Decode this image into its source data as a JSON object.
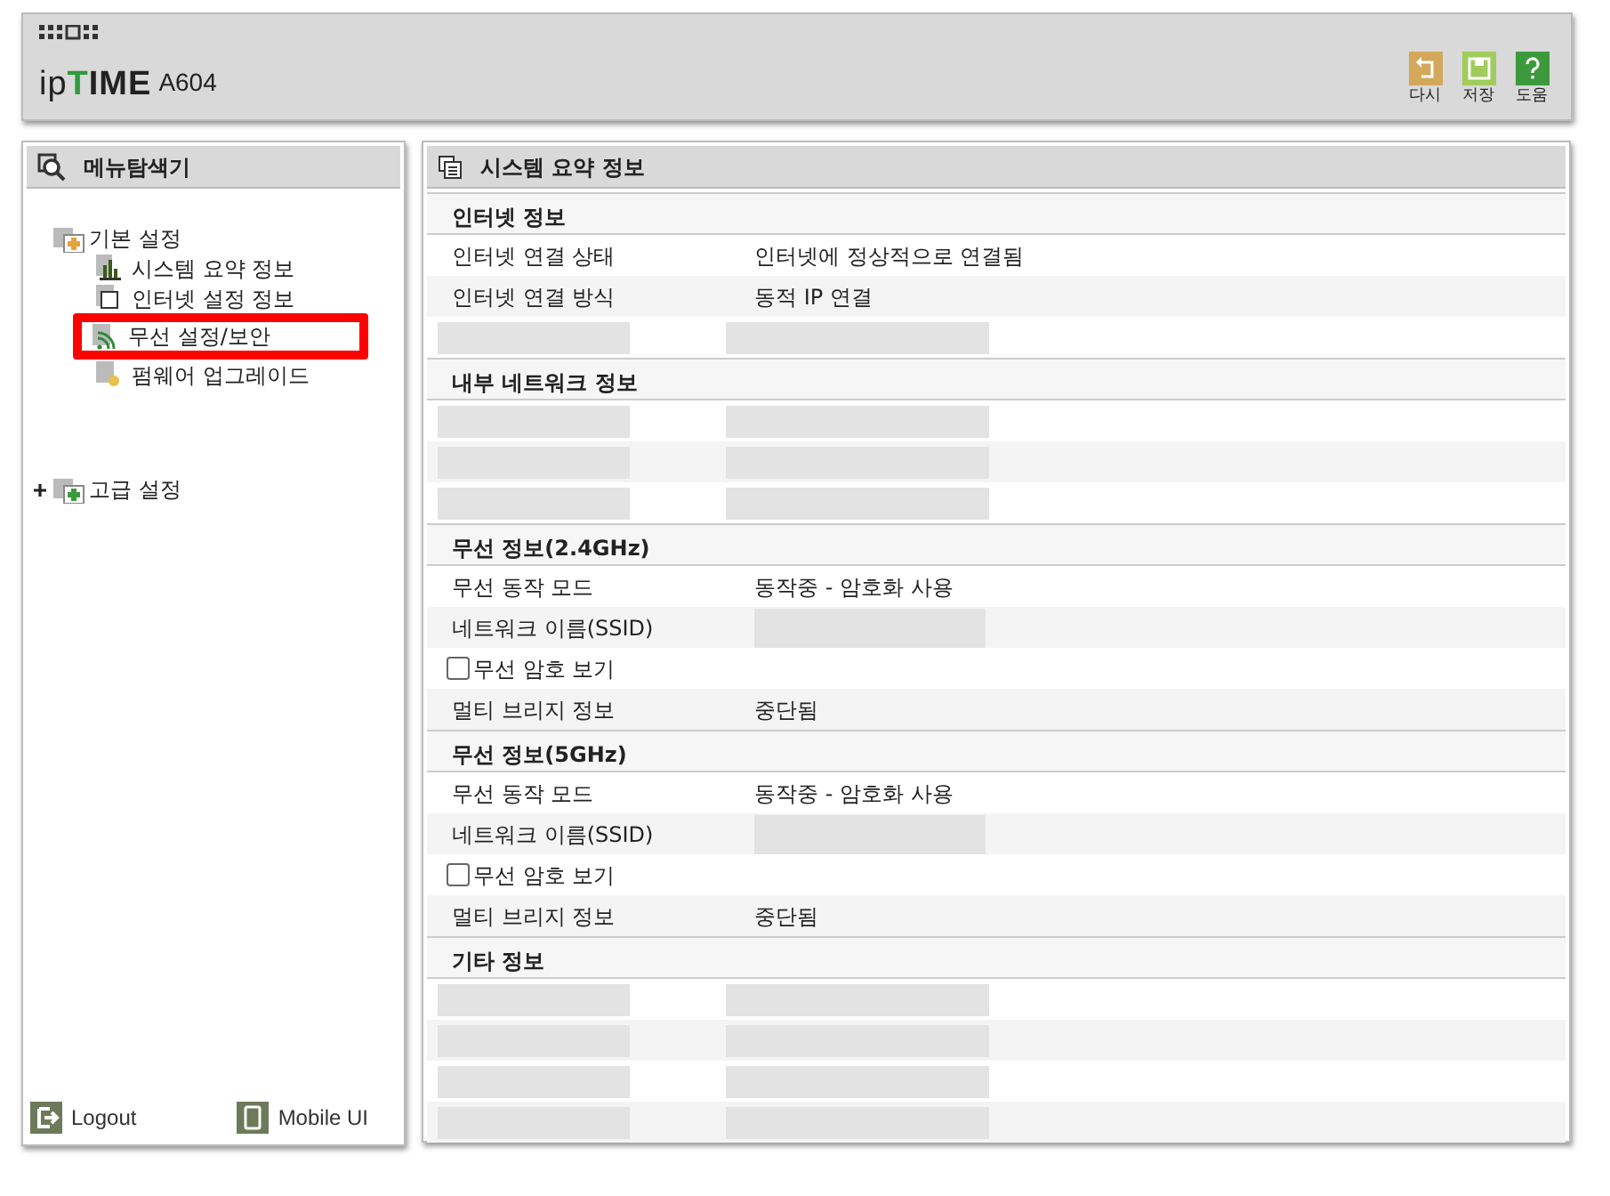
{
  "header": {
    "logo": "ipTIME",
    "model": "A604",
    "tools": [
      {
        "label": "다시",
        "kind": "undo"
      },
      {
        "label": "저장",
        "kind": "save"
      },
      {
        "label": "도움",
        "kind": "help"
      }
    ]
  },
  "sidebar": {
    "title": "메뉴탐색기",
    "tree": [
      {
        "label": "기본 설정",
        "expanded": true,
        "children": [
          {
            "label": "시스템 요약 정보",
            "kind": "chart",
            "highlighted": false
          },
          {
            "label": "인터넷 설정 정보",
            "kind": "internet",
            "highlighted": false
          },
          {
            "label": "무선 설정/보안",
            "kind": "wireless",
            "highlighted": true
          },
          {
            "label": "펌웨어 업그레이드",
            "kind": "firmware",
            "highlighted": false
          }
        ]
      },
      {
        "label": "고급 설정",
        "expanded": false
      }
    ],
    "links": [
      {
        "label": "Logout",
        "kind": "logout"
      },
      {
        "label": "Mobile UI",
        "kind": "mobile"
      }
    ]
  },
  "main": {
    "title": "시스템 요약 정보",
    "sections": [
      {
        "title": "인터넷 정보",
        "rows": [
          {
            "kind": "field",
            "label": "인터넷 연결 상태",
            "value": "인터넷에 정상적으로 연결됨"
          },
          {
            "kind": "field",
            "label": "인터넷 연결 방식",
            "value": "동적 IP 연결"
          },
          {
            "kind": "redacted"
          }
        ]
      },
      {
        "title": "내부 네트워크 정보",
        "rows": [
          {
            "kind": "redacted"
          },
          {
            "kind": "redacted"
          },
          {
            "kind": "redacted"
          }
        ]
      },
      {
        "title": "무선 정보(2.4GHz)",
        "rows": [
          {
            "kind": "field",
            "label": "무선 동작 모드",
            "value": "동작중 - 암호화 사용"
          },
          {
            "kind": "field",
            "label": "네트워크 이름(SSID)"
          },
          {
            "kind": "checkbox",
            "label": "무선 암호 보기",
            "checked": false
          },
          {
            "kind": "field",
            "label": "멀티 브리지 정보",
            "value": "중단됨"
          }
        ]
      },
      {
        "title": "무선 정보(5GHz)",
        "rows": [
          {
            "kind": "field",
            "label": "무선 동작 모드",
            "value": "동작중 - 암호화 사용"
          },
          {
            "kind": "field",
            "label": "네트워크 이름(SSID)"
          },
          {
            "kind": "checkbox",
            "label": "무선 암호 보기",
            "checked": false
          },
          {
            "kind": "field",
            "label": "멀티 브리지 정보",
            "value": "중단됨"
          }
        ]
      },
      {
        "title": "기타 정보",
        "rows": [
          {
            "kind": "redacted"
          },
          {
            "kind": "redacted"
          },
          {
            "kind": "redacted"
          },
          {
            "kind": "redacted"
          }
        ]
      }
    ]
  }
}
